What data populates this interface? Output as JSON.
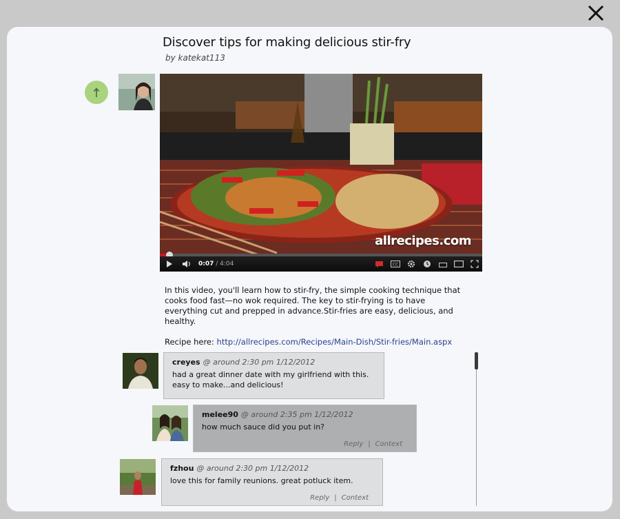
{
  "window": {
    "close_icon": "close-x-icon"
  },
  "post": {
    "title": "Discover tips for making delicious stir-fry",
    "byline": "by katekat113",
    "upvote_icon": "arrow-up-icon",
    "upvote_color": "#a9d37f"
  },
  "video": {
    "watermark": "allrecipes.com",
    "current_time": "0:07",
    "duration": "/ 4:04",
    "progress_fraction": 0.029,
    "controls": [
      "play-icon",
      "volume-icon",
      "annotations-icon",
      "captions-icon",
      "settings-icon",
      "watch-later-icon",
      "small-player-icon",
      "large-player-icon",
      "fullscreen-icon"
    ]
  },
  "description": {
    "text": "In this video, you'll learn how to stir-fry, the simple cooking technique that cooks food fast—no wok required. The key to stir-frying is to have everything cut and prepped in advance.Stir-fries are easy, delicious, and healthy.",
    "recipe_label": "Recipe here: ",
    "recipe_url": "http://allrecipes.com/Recipes/Main-Dish/Stir-fries/Main.aspx"
  },
  "comments": [
    {
      "user": "creyes",
      "time": "@ around 2:30 pm 1/12/2012",
      "line1": "had a great dinner date with my girlfriend with this.",
      "line2": "easy to make...and delicious!"
    },
    {
      "user": "melee90",
      "time": "@ around 2:35 pm 1/12/2012",
      "line1": "how much sauce did you put in?",
      "reply_label": "Reply",
      "context_label": "Context"
    },
    {
      "user": "fzhou",
      "time": "@ around 2:30 pm 1/12/2012",
      "line1": "love this for family reunions. great potluck item.",
      "reply_label": "Reply",
      "context_label": "Context"
    }
  ],
  "separator": "|"
}
